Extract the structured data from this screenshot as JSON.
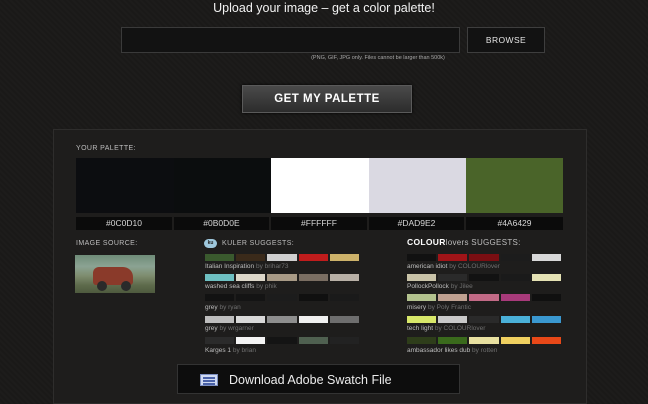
{
  "header": {
    "title": "Upload your image – get a color palette!",
    "browse_label": "BROWSE",
    "file_note": "(PNG, GIF, JPG only. Files cannot be larger than 500k)",
    "submit_label": "GET MY PALETTE"
  },
  "palette": {
    "title": "YOUR PALETTE:",
    "colors": [
      {
        "hex": "#0C0D10",
        "label": "#0C0D10"
      },
      {
        "hex": "#0B0D0E",
        "label": "#0B0D0E"
      },
      {
        "hex": "#FFFFFF",
        "label": "#FFFFFF"
      },
      {
        "hex": "#DAD9E2",
        "label": "#DAD9E2"
      },
      {
        "hex": "#4A6429",
        "label": "#4A6429"
      }
    ]
  },
  "image_source": {
    "title": "IMAGE SOURCE:"
  },
  "kuler": {
    "logo_text": "ku",
    "title": "KULER SUGGESTS:",
    "items": [
      {
        "name": "Italian Inspiration",
        "by": "by brihar73",
        "colors": [
          "#3a5a2e",
          "#3a2a1a",
          "#cfcfcf",
          "#c01c1c",
          "#cdb26a"
        ]
      },
      {
        "name": "washed sea cliffs",
        "by": "by phik",
        "colors": [
          "#6ec0c2",
          "#dcd7c9",
          "#a89a86",
          "#7a6e62",
          "#b8b0a6"
        ]
      },
      {
        "name": "grey",
        "by": "by ryan",
        "colors": [
          "#121212",
          "#141414",
          "#1c1c1c",
          "#101010",
          "#1a1a1a"
        ]
      },
      {
        "name": "grey",
        "by": "by wrgarner",
        "colors": [
          "#bdbdbd",
          "#d8d8d8",
          "#8e8e8e",
          "#f0f0f0",
          "#6e6e6e"
        ]
      },
      {
        "name": "Karges 1",
        "by": "by brian",
        "colors": [
          "#2b2b2b",
          "#f4f4f4",
          "#141414",
          "#4f6050",
          "#222222"
        ]
      }
    ]
  },
  "colourlovers": {
    "brand_bold": "COLOUR",
    "brand_rest": "lovers",
    "suggests": " SUGGESTS:",
    "items": [
      {
        "name": "american idiot",
        "by": "by COLOURlover",
        "colors": [
          "#111111",
          "#a01418",
          "#7a0e12",
          "#1c1c1c",
          "#d8d8d8"
        ]
      },
      {
        "name": "PollockPollock",
        "by": "by Jilee",
        "colors": [
          "#c9c3a8",
          "#2a2a2a",
          "#121212",
          "#1a1a1a",
          "#e5e2b4"
        ]
      },
      {
        "name": "misery",
        "by": "by Poly Frantic",
        "colors": [
          "#b3c28e",
          "#bfa090",
          "#c26a86",
          "#a83a7a",
          "#101010"
        ]
      },
      {
        "name": "tech light",
        "by": "by COLOURlover",
        "colors": [
          "#d8e86a",
          "#c9c9c9",
          "#2a2a2a",
          "#4ab0d8",
          "#3a98d0"
        ]
      },
      {
        "name": "ambassador likes dub",
        "by": "by rotten",
        "colors": [
          "#2e3d1a",
          "#3a6a1c",
          "#e8e0a0",
          "#f0d060",
          "#e84818"
        ]
      }
    ]
  },
  "download": {
    "label": "Download Adobe Swatch File"
  }
}
